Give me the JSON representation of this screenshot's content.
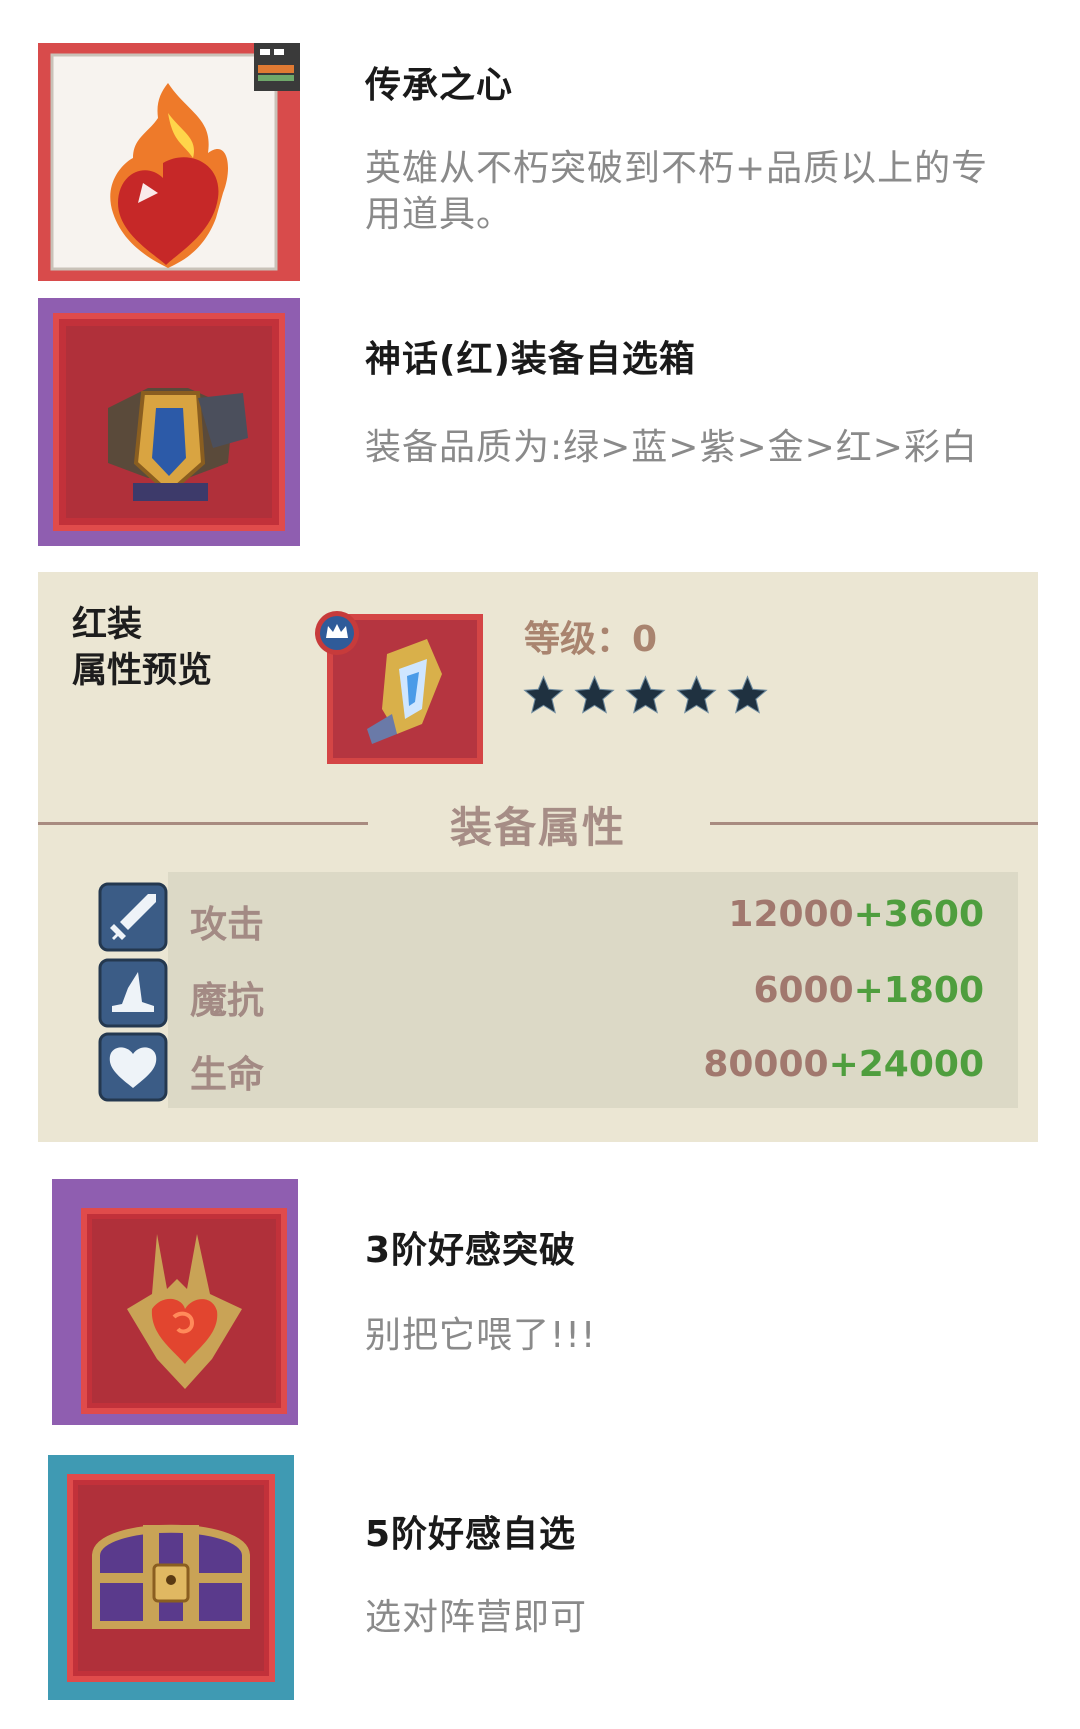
{
  "items_top": [
    {
      "title": "传承之心",
      "desc": "英雄从不朽突破到不朽+品质以上的专用道具。",
      "icon": "flaming-heart-icon",
      "frame_color": "#d84b4b"
    },
    {
      "title": "神话(红)装备自选箱",
      "desc": "装备品质为:绿>蓝>紫>金>红>彩白",
      "icon": "armor-chest-icon",
      "frame_color": "#8f5eb0"
    }
  ],
  "preview": {
    "label_line1": "红装",
    "label_line2": "属性预览",
    "level_text": "等级：0",
    "stars_count": 5,
    "equip_icon": "crystal-sword-icon",
    "badge_icon": "crown-badge-icon",
    "section_title": "装备属性",
    "stats": [
      {
        "icon": "sword-icon",
        "name": "攻击",
        "base": "12000",
        "plus": "+3600"
      },
      {
        "icon": "wizard-hat-icon",
        "name": "魔抗",
        "base": "6000",
        "plus": "+1800"
      },
      {
        "icon": "heart-icon",
        "name": "生命",
        "base": "80000",
        "plus": "+24000"
      }
    ]
  },
  "items_bottom": [
    {
      "title": "3阶好感突破",
      "desc": "别把它喂了!!!",
      "icon": "golden-heart-relic-icon",
      "frame_color": "#8f5eb0"
    },
    {
      "title": "5阶好感自选",
      "desc": "选对阵营即可",
      "icon": "treasure-chest-icon",
      "frame_color": "#3f9ab3"
    }
  ],
  "colors": {
    "panel_bg": "#ebe6d3",
    "stat_plus": "#4f9e3e",
    "stat_base": "#a1786e",
    "star_fill": "#1f3140"
  }
}
